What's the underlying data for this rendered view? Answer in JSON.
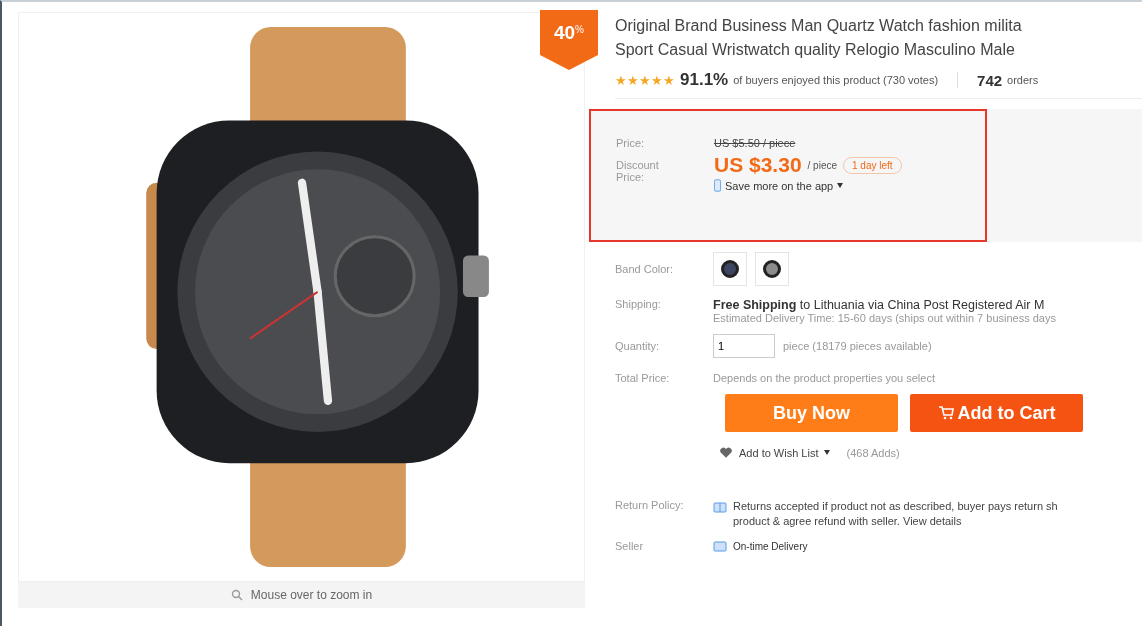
{
  "badge": {
    "value": "40",
    "unit": "%"
  },
  "zoom_hint": "Mouse over to zoom in",
  "product": {
    "title_lines": [
      "Original Brand Business Man Quartz Watch fashion milita",
      "Sport Casual Wristwatch quality Relogio Masculino Male"
    ],
    "stars": 5,
    "rating": "91.1%",
    "rating_text": "of buyers enjoyed this product (730 votes)",
    "orders_count": "742",
    "orders_label": "orders"
  },
  "price_box": {
    "price_label": "Price:",
    "original_price": "US $5.50 / piece",
    "discount_label": "Discount Price:",
    "discount_price": "US $3.30",
    "unit": "/ piece",
    "time_left": "1 day left",
    "app_promo": "Save more on the app"
  },
  "band_color": {
    "label": "Band Color:",
    "swatches": [
      {
        "color": "#3c4660"
      },
      {
        "color": "#8c8c8c"
      }
    ]
  },
  "shipping": {
    "label": "Shipping:",
    "highlight": "Free Shipping",
    "text": "to Lithuania via China Post Registered Air M",
    "estimate": "Estimated Delivery Time: 15-60 days (ships out within 7 business days"
  },
  "quantity": {
    "label": "Quantity:",
    "value": "1",
    "note": "piece (18179 pieces available)"
  },
  "total": {
    "label": "Total Price:",
    "text": "Depends on the product properties you select"
  },
  "buttons": [
    {
      "kind": "buy",
      "label": "Buy Now"
    },
    {
      "kind": "cart",
      "label": "Add to Cart"
    }
  ],
  "wishlist": {
    "label": "Add to Wish List",
    "count": "(468 Adds)"
  },
  "return_policy": {
    "label": "Return Policy:",
    "text": "Returns accepted if product not as described, buyer pays return sh",
    "text_2": "product & agree refund with seller.",
    "link": "View details"
  },
  "seller": {
    "label": "Seller",
    "text": "On-time Delivery"
  }
}
